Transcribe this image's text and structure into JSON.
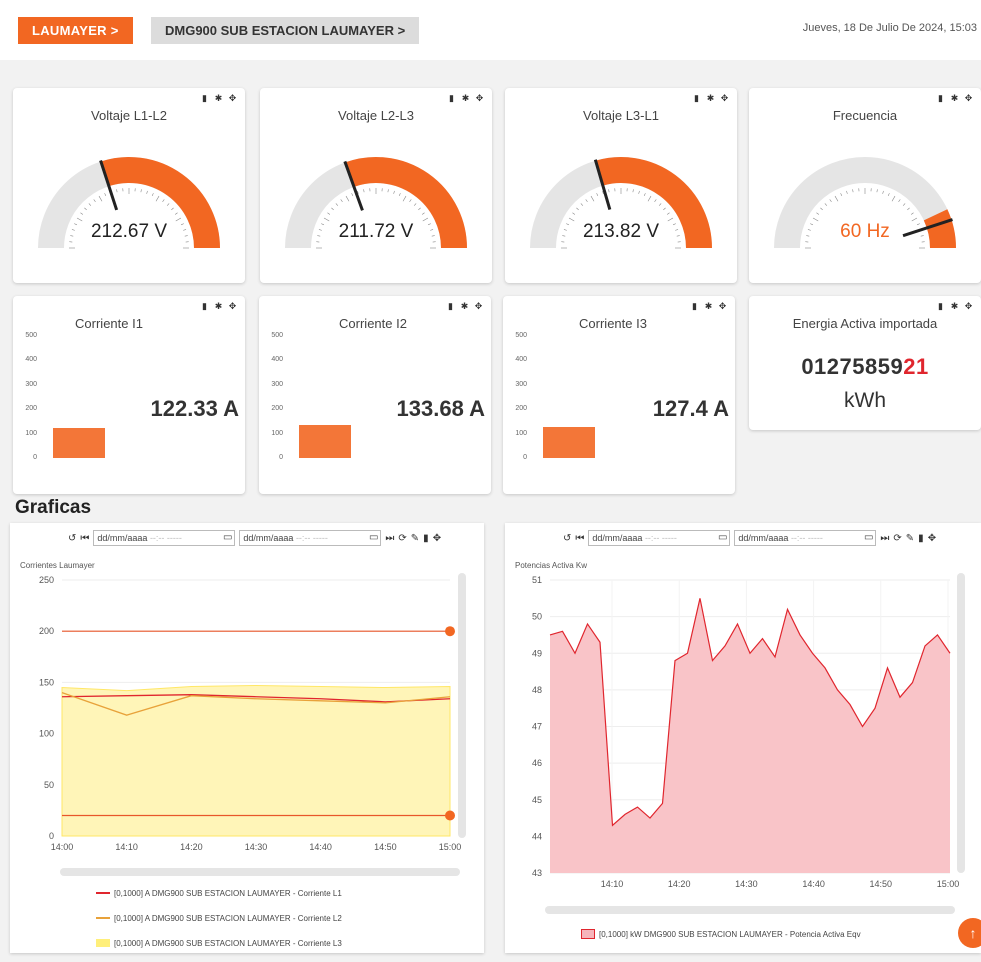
{
  "header": {
    "crumb1": "LAUMAYER >",
    "crumb2": "DMG900 SUB ESTACION LAUMAYER >",
    "datetime": "Jueves, 18 De Julio De 2024, 15:03"
  },
  "gauges": [
    {
      "title": "Voltaje L1-L2",
      "value": 212.67,
      "display": "212.67 V",
      "min": 0,
      "max": 300,
      "ticks": [
        "0",
        "20",
        "100",
        "150",
        "200",
        "250",
        "300",
        "350",
        "400",
        "450",
        "500"
      ]
    },
    {
      "title": "Voltaje L2-L3",
      "value": 211.72,
      "display": "211.72 V"
    },
    {
      "title": "Voltaje L3-L1",
      "value": 213.82,
      "display": "213.82 V"
    },
    {
      "title": "Frecuencia",
      "value": 60,
      "display": "60 Hz"
    }
  ],
  "bars": [
    {
      "title": "Corriente I1",
      "value": 122.33,
      "display": "122.33 A"
    },
    {
      "title": "Corriente I2",
      "value": 133.68,
      "display": "133.68 A"
    },
    {
      "title": "Corriente I3",
      "value": 127.4,
      "display": "127.4 A"
    }
  ],
  "bar_axis": [
    "500",
    "400",
    "300",
    "200",
    "100",
    "0"
  ],
  "energy": {
    "title": "Energia Activa importada",
    "digits_main": "01275859",
    "digits_hl": "21",
    "unit": "kWh"
  },
  "section_title": "Graficas",
  "toolbar": {
    "date_placeholder": "dd/mm/aaaa",
    "time_placeholder": "--:-- -----"
  },
  "chart_left": {
    "name": "Corrientes Laumayer",
    "legend": [
      "[0,1000] A DMG900 SUB ESTACION LAUMAYER - Corriente L1",
      "[0,1000] A DMG900 SUB ESTACION LAUMAYER - Corriente L2",
      "[0,1000] A DMG900 SUB ESTACION LAUMAYER - Corriente L3"
    ]
  },
  "chart_right": {
    "name": "Potencias Activa Kw",
    "legend": [
      "[0,1000] kW DMG900 SUB ESTACION LAUMAYER - Potencia Activa Eqv"
    ]
  },
  "chart_data": [
    {
      "type": "line",
      "title": "Corrientes Laumayer",
      "x": [
        "14:00",
        "14:10",
        "14:20",
        "14:30",
        "14:40",
        "14:50",
        "15:00"
      ],
      "ylim": [
        0,
        250
      ],
      "yticks": [
        "0",
        "50",
        "100",
        "150",
        "200",
        "250"
      ],
      "series": [
        {
          "name": "[0,1000] A DMG900 SUB ESTACION LAUMAYER - Corriente L1",
          "color": "#e0262e",
          "values": [
            136,
            137,
            138,
            136,
            134,
            131,
            134
          ]
        },
        {
          "name": "[0,1000] A DMG900 SUB ESTACION LAUMAYER - Corriente L2",
          "color": "#e8a23a",
          "values": [
            140,
            118,
            137,
            134,
            132,
            130,
            136
          ]
        },
        {
          "name": "[0,1000] A DMG900 SUB ESTACION LAUMAYER - Corriente L3",
          "color": "#fff3a6",
          "values": [
            145,
            142,
            146,
            147,
            146,
            145,
            146
          ]
        }
      ],
      "threshold_lines": [
        200,
        20
      ]
    },
    {
      "type": "area",
      "title": "Potencias Activa Kw",
      "x": [
        "14:10",
        "14:20",
        "14:30",
        "14:40",
        "14:50",
        "15:00"
      ],
      "ylim": [
        43,
        51
      ],
      "yticks": [
        "43",
        "44",
        "45",
        "46",
        "47",
        "48",
        "49",
        "50",
        "51"
      ],
      "series": [
        {
          "name": "[0,1000] kW DMG900 SUB ESTACION LAUMAYER - Potencia Activa Eqv",
          "color": "#e0262e",
          "values": [
            49.5,
            49.6,
            49.0,
            49.8,
            49.3,
            44.3,
            44.6,
            44.8,
            44.5,
            44.9,
            48.8,
            49.0,
            50.5,
            48.8,
            49.2,
            49.8,
            49.0,
            49.4,
            48.9,
            50.2,
            49.5,
            49.0,
            48.6,
            48.0,
            47.6,
            47.0,
            47.5,
            48.6,
            47.8,
            48.2,
            49.2,
            49.5,
            49.0
          ]
        }
      ]
    }
  ]
}
